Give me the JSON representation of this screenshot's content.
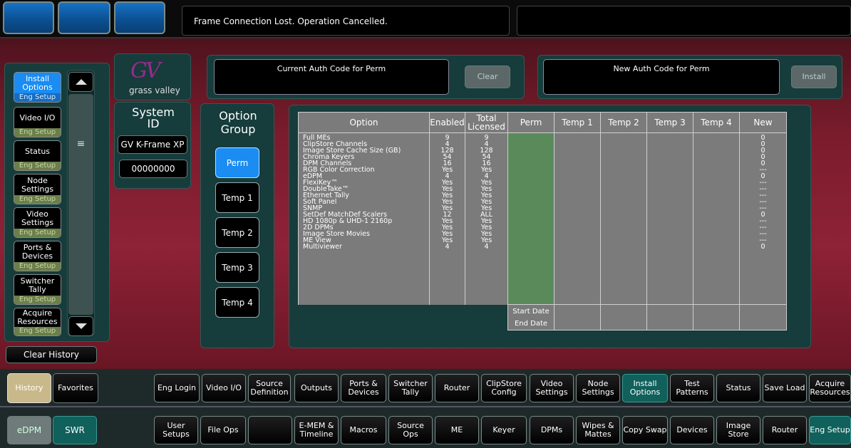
{
  "top": {
    "message": "Frame Connection Lost. Operation Cancelled."
  },
  "sidebar": {
    "items": [
      {
        "label": "Install Options",
        "sub": "Eng Setup"
      },
      {
        "label": "Video I/O",
        "sub": "Eng Setup"
      },
      {
        "label": "Status",
        "sub": "Eng Setup"
      },
      {
        "label": "Node Settings",
        "sub": "Eng Setup"
      },
      {
        "label": "Video Settings",
        "sub": "Eng Setup"
      },
      {
        "label": "Ports & Devices",
        "sub": "Eng Setup"
      },
      {
        "label": "Switcher Tally",
        "sub": "Eng Setup"
      },
      {
        "label": "Acquire Resources",
        "sub": "Eng Setup"
      }
    ],
    "clear_history": "Clear History",
    "history": "History",
    "favorites": "Favorites",
    "edpm": "eDPM",
    "swr": "SWR"
  },
  "logo": {
    "text": "grass valley",
    "mark": "GV"
  },
  "system": {
    "title": "System ID",
    "model": "GV K-Frame XP",
    "id": "00000000"
  },
  "auth": {
    "current_label": "Current Auth Code for Perm",
    "new_label": "New Auth Code for Perm",
    "clear": "Clear",
    "install": "Install"
  },
  "option_group": {
    "title": "Option Group",
    "buttons": [
      "Perm",
      "Temp 1",
      "Temp 2",
      "Temp 3",
      "Temp 4"
    ]
  },
  "table": {
    "headers": {
      "option": "Option",
      "enabled": "Enabled",
      "total": "Total Licensed",
      "perm": "Perm",
      "temp1": "Temp 1",
      "temp2": "Temp 2",
      "temp3": "Temp 3",
      "temp4": "Temp 4",
      "new": "New"
    },
    "options": [
      "Full MEs",
      "ClipStore Channels",
      "Image Store Cache Size (GB)",
      "Chroma Keyers",
      "DPM Channels",
      "RGB Color Correction",
      "eDPM",
      "FlexiKey™",
      "DoubleTake™",
      "Ethernet Tally",
      "Soft Panel",
      "SNMP",
      "SetDef MatchDef Scalers",
      "HD 1080p & UHD-1 2160p",
      "2D DPMs",
      "Image Store Movies",
      "ME View",
      "Multiviewer"
    ],
    "enabled": [
      "9",
      "4",
      "128",
      "54",
      "16",
      "Yes",
      "4",
      "Yes",
      "Yes",
      "Yes",
      "Yes",
      "Yes",
      "12",
      "Yes",
      "Yes",
      "Yes",
      "Yes",
      "4"
    ],
    "total": [
      "9",
      "4",
      "128",
      "54",
      "16",
      "Yes",
      "4",
      "Yes",
      "Yes",
      "Yes",
      "Yes",
      "Yes",
      "ALL",
      "Yes",
      "Yes",
      "Yes",
      "Yes",
      "4"
    ],
    "new": [
      "0",
      "0",
      "0",
      "0",
      "0",
      "---",
      "0",
      "---",
      "---",
      "---",
      "---",
      "---",
      "0",
      "---",
      "---",
      "---",
      "---",
      "0"
    ],
    "start_date": "Start Date",
    "end_date": "End Date"
  },
  "tabs_row1": [
    "Eng Login",
    "Video I/O",
    "Source Definition",
    "Outputs",
    "Ports & Devices",
    "Switcher Tally",
    "Router",
    "ClipStore Config",
    "Video Settings",
    "Node Settings",
    "Install Options",
    "Test Patterns",
    "Status",
    "Save Load",
    "Acquire Resources"
  ],
  "tabs_row2": [
    "User Setups",
    "File Ops",
    "",
    "E-MEM & Timeline",
    "Macros",
    "Source Ops",
    "ME",
    "Keyer",
    "DPMs",
    "Wipes & Mattes",
    "Copy Swap",
    "Devices",
    "Image Store",
    "Router",
    "Eng Setup"
  ]
}
